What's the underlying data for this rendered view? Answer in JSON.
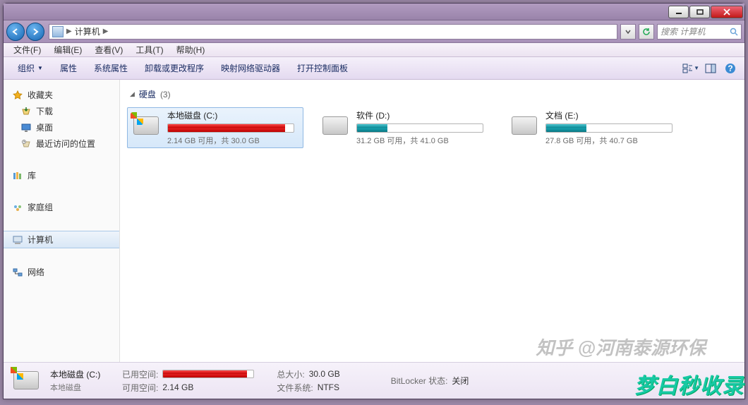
{
  "breadcrumb": {
    "root_icon": "computer",
    "path0": "计算机",
    "search_placeholder": "搜索 计算机"
  },
  "menubar": {
    "file": "文件(F)",
    "edit": "编辑(E)",
    "view": "查看(V)",
    "tools": "工具(T)",
    "help": "帮助(H)"
  },
  "cmdbar": {
    "organize": "组织",
    "properties": "属性",
    "sys_properties": "系统属性",
    "uninstall": "卸载或更改程序",
    "map_drive": "映射网络驱动器",
    "control_panel": "打开控制面板"
  },
  "sidebar": {
    "favorites": "收藏夹",
    "downloads": "下载",
    "desktop": "桌面",
    "recent": "最近访问的位置",
    "libraries": "库",
    "homegroup": "家庭组",
    "computer": "计算机",
    "network": "网络"
  },
  "group": {
    "label": "硬盘",
    "count": "(3)"
  },
  "drives": [
    {
      "name": "本地磁盘 (C:)",
      "used_pct": 93,
      "color": "red",
      "stat": "2.14 GB 可用，共 30.0 GB",
      "badge": "win",
      "selected": true
    },
    {
      "name": "软件 (D:)",
      "used_pct": 24,
      "color": "teal",
      "stat": "31.2 GB 可用，共 41.0 GB",
      "badge": "",
      "selected": false
    },
    {
      "name": "文档 (E:)",
      "used_pct": 32,
      "color": "teal",
      "stat": "27.8 GB 可用，共 40.7 GB",
      "badge": "",
      "selected": false
    }
  ],
  "details": {
    "title": "本地磁盘 (C:)",
    "subtitle": "本地磁盘",
    "used_label": "已用空间:",
    "free_label": "可用空间:",
    "free_value": "2.14 GB",
    "total_label": "总大小:",
    "total_value": "30.0 GB",
    "fs_label": "文件系统:",
    "fs_value": "NTFS",
    "bitlocker_label": "BitLocker 状态:",
    "bitlocker_value": "关闭",
    "used_pct": 93
  },
  "watermark1": "知乎 @河南泰源环保",
  "watermark2": "梦白秒收录"
}
